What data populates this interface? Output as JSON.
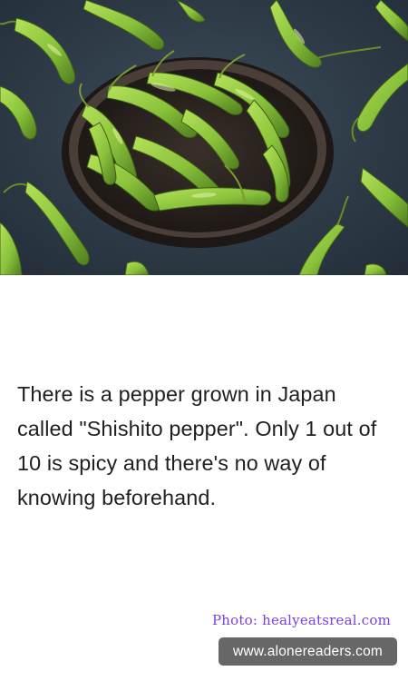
{
  "photo": {
    "subject": "bowl of green shishito peppers on a dark slate surface",
    "colors": {
      "background": "#2e3c4a",
      "pepper": "#8cc63a",
      "bowl": "#2a2523"
    }
  },
  "fact": {
    "text": "There is a pepper grown in Japan called \"Shishito pepper\". Only 1 out of 10 is spicy and there's no way of knowing beforehand."
  },
  "credit": {
    "text": "Photo: healyeatsreal.com",
    "color": "#7a3fe0"
  },
  "site": {
    "text": "www.alonereaders.com",
    "background": "#666766"
  }
}
